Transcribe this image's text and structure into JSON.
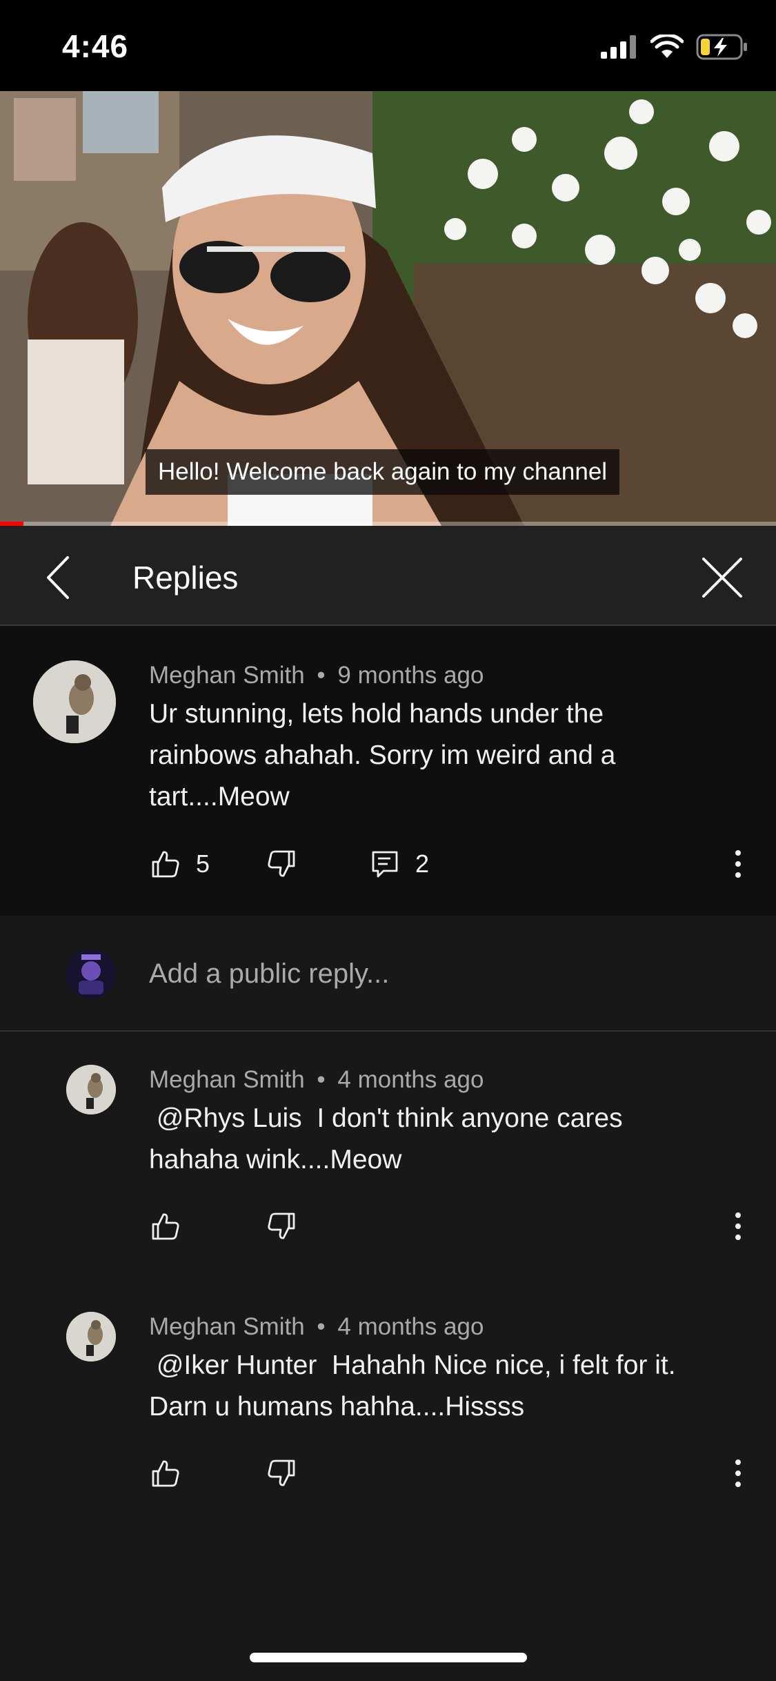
{
  "status_bar": {
    "time": "4:46"
  },
  "video": {
    "caption": "Hello! Welcome back again to my channel",
    "progress": 0.03,
    "colors": {
      "progress": "#ff0000"
    }
  },
  "header": {
    "title": "Replies"
  },
  "parent_comment": {
    "author": "Meghan Smith",
    "age": "9 months ago",
    "text": "Ur stunning, lets hold hands under the rainbows ahahah. Sorry im weird and a tart....Meow",
    "likes": "5",
    "replies": "2"
  },
  "add_reply": {
    "placeholder": "Add a public reply..."
  },
  "replies": [
    {
      "author": "Meghan Smith",
      "age": "4 months ago",
      "text": " @Rhys Luis  I don't think anyone cares hahaha wink....Meow"
    },
    {
      "author": "Meghan Smith",
      "age": "4 months ago",
      "text": " @Iker Hunter  Hahahh Nice nice, i felt for it. Darn u humans hahha....Hissss"
    }
  ],
  "separator": "•",
  "icons": {
    "back": "chevron-left-icon",
    "close": "close-icon",
    "like": "thumbs-up-icon",
    "dislike": "thumbs-down-icon",
    "reply": "comment-icon",
    "more": "more-vertical-icon"
  }
}
